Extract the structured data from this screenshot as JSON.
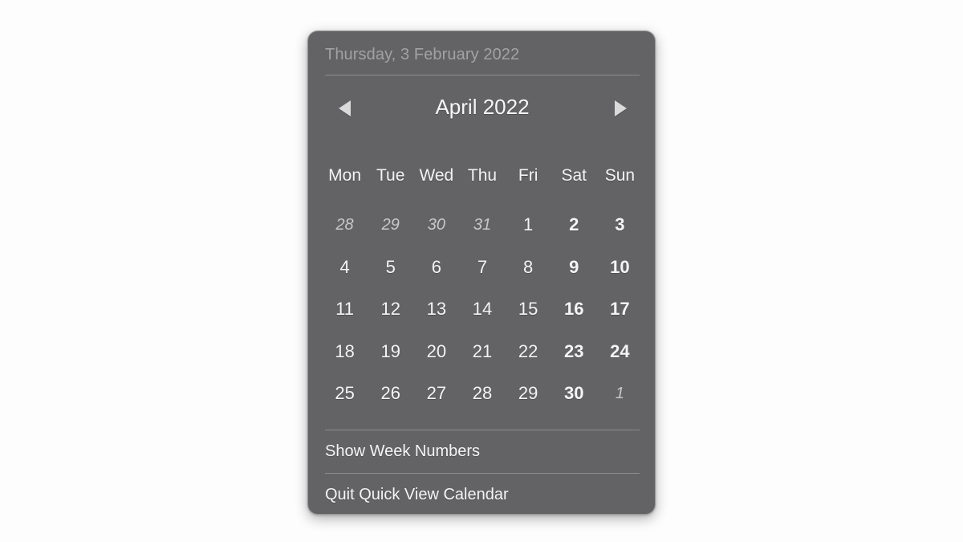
{
  "panel": {
    "header_date": "Thursday, 3 February 2022",
    "bg_color": "#636366",
    "text_color": "#f4f4f4"
  },
  "nav": {
    "prev_label": "◀",
    "next_label": "▶",
    "month_title": "April 2022"
  },
  "weekdays": [
    {
      "label": "Mon"
    },
    {
      "label": "Tue"
    },
    {
      "label": "Wed"
    },
    {
      "label": "Thu"
    },
    {
      "label": "Fri"
    },
    {
      "label": "Sat"
    },
    {
      "label": "Sun"
    }
  ],
  "days": [
    {
      "n": "28",
      "adjacent": true,
      "weekend": false
    },
    {
      "n": "29",
      "adjacent": true,
      "weekend": false
    },
    {
      "n": "30",
      "adjacent": true,
      "weekend": false
    },
    {
      "n": "31",
      "adjacent": true,
      "weekend": false
    },
    {
      "n": "1",
      "adjacent": false,
      "weekend": false
    },
    {
      "n": "2",
      "adjacent": false,
      "weekend": true
    },
    {
      "n": "3",
      "adjacent": false,
      "weekend": true
    },
    {
      "n": "4",
      "adjacent": false,
      "weekend": false
    },
    {
      "n": "5",
      "adjacent": false,
      "weekend": false
    },
    {
      "n": "6",
      "adjacent": false,
      "weekend": false
    },
    {
      "n": "7",
      "adjacent": false,
      "weekend": false
    },
    {
      "n": "8",
      "adjacent": false,
      "weekend": false
    },
    {
      "n": "9",
      "adjacent": false,
      "weekend": true
    },
    {
      "n": "10",
      "adjacent": false,
      "weekend": true
    },
    {
      "n": "11",
      "adjacent": false,
      "weekend": false
    },
    {
      "n": "12",
      "adjacent": false,
      "weekend": false
    },
    {
      "n": "13",
      "adjacent": false,
      "weekend": false
    },
    {
      "n": "14",
      "adjacent": false,
      "weekend": false
    },
    {
      "n": "15",
      "adjacent": false,
      "weekend": false
    },
    {
      "n": "16",
      "adjacent": false,
      "weekend": true
    },
    {
      "n": "17",
      "adjacent": false,
      "weekend": true
    },
    {
      "n": "18",
      "adjacent": false,
      "weekend": false
    },
    {
      "n": "19",
      "adjacent": false,
      "weekend": false
    },
    {
      "n": "20",
      "adjacent": false,
      "weekend": false
    },
    {
      "n": "21",
      "adjacent": false,
      "weekend": false
    },
    {
      "n": "22",
      "adjacent": false,
      "weekend": false
    },
    {
      "n": "23",
      "adjacent": false,
      "weekend": true
    },
    {
      "n": "24",
      "adjacent": false,
      "weekend": true
    },
    {
      "n": "25",
      "adjacent": false,
      "weekend": false
    },
    {
      "n": "26",
      "adjacent": false,
      "weekend": false
    },
    {
      "n": "27",
      "adjacent": false,
      "weekend": false
    },
    {
      "n": "28",
      "adjacent": false,
      "weekend": false
    },
    {
      "n": "29",
      "adjacent": false,
      "weekend": false
    },
    {
      "n": "30",
      "adjacent": false,
      "weekend": true
    },
    {
      "n": "1",
      "adjacent": true,
      "weekend": true
    },
    {
      "n": "",
      "adjacent": false,
      "weekend": false,
      "empty": true
    },
    {
      "n": "",
      "adjacent": false,
      "weekend": false,
      "empty": true
    },
    {
      "n": "",
      "adjacent": false,
      "weekend": false,
      "empty": true
    },
    {
      "n": "",
      "adjacent": false,
      "weekend": false,
      "empty": true
    },
    {
      "n": "",
      "adjacent": false,
      "weekend": false,
      "empty": true
    },
    {
      "n": "",
      "adjacent": false,
      "weekend": false,
      "empty": true
    },
    {
      "n": "",
      "adjacent": false,
      "weekend": false,
      "empty": true
    }
  ],
  "menu": {
    "show_week_numbers": "Show Week Numbers",
    "quit": "Quit Quick View Calendar"
  }
}
